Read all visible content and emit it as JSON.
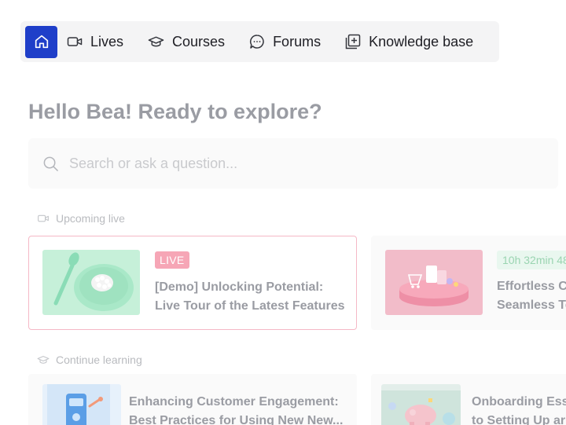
{
  "nav": {
    "home_icon": "home-icon",
    "items": [
      {
        "label": "Lives",
        "icon": "video-icon"
      },
      {
        "label": "Courses",
        "icon": "graduation-cap-icon"
      },
      {
        "label": "Forums",
        "icon": "chat-bubble-icon"
      },
      {
        "label": "Knowledge base",
        "icon": "plus-square-icon"
      }
    ],
    "accent": "#1f3fc9"
  },
  "greeting": "Hello Bea! Ready to explore?",
  "search": {
    "placeholder": "Search or ask a question...",
    "icon": "search-icon"
  },
  "upcoming": {
    "label": "Upcoming live",
    "cards": [
      {
        "badge": "LIVE",
        "title_line1": "[Demo] Unlocking Potential:",
        "title_line2": "Live Tour of the Latest Features"
      },
      {
        "badge": "10h 32min 48",
        "title_line1": "Effortless C",
        "title_line2": "Seamless Te"
      }
    ]
  },
  "continue": {
    "label": "Continue learning",
    "cards": [
      {
        "title_line1": "Enhancing Customer Engagement:",
        "title_line2": "Best Practices for Using New New..."
      },
      {
        "title_line1": "Onboarding Ess",
        "title_line2": "to Setting Up ar"
      }
    ]
  }
}
